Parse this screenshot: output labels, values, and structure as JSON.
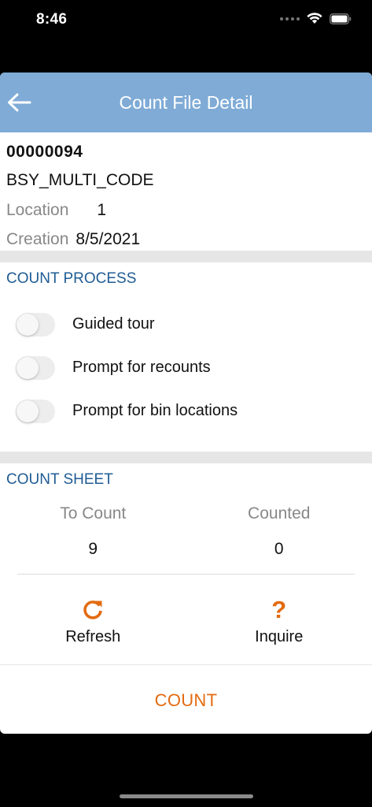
{
  "status_bar": {
    "time": "8:46"
  },
  "header": {
    "title": "Count File Detail"
  },
  "file": {
    "number": "00000094",
    "code": "BSY_MULTI_CODE",
    "location_label": "Location",
    "location_value": "1",
    "creation_label": "Creation",
    "creation_value": "8/5/2021"
  },
  "count_process": {
    "title": "COUNT PROCESS",
    "toggles": [
      {
        "label": "Guided tour",
        "enabled": false
      },
      {
        "label": "Prompt for recounts",
        "enabled": false
      },
      {
        "label": "Prompt for bin locations",
        "enabled": false
      }
    ]
  },
  "count_sheet": {
    "title": "COUNT SHEET",
    "to_count_label": "To Count",
    "to_count_value": "9",
    "counted_label": "Counted",
    "counted_value": "0",
    "refresh_label": "Refresh",
    "inquire_label": "Inquire"
  },
  "footer": {
    "count_label": "COUNT"
  },
  "colors": {
    "header": "#7fabd6",
    "section_title": "#1f5c94",
    "accent": "#e36b10"
  }
}
